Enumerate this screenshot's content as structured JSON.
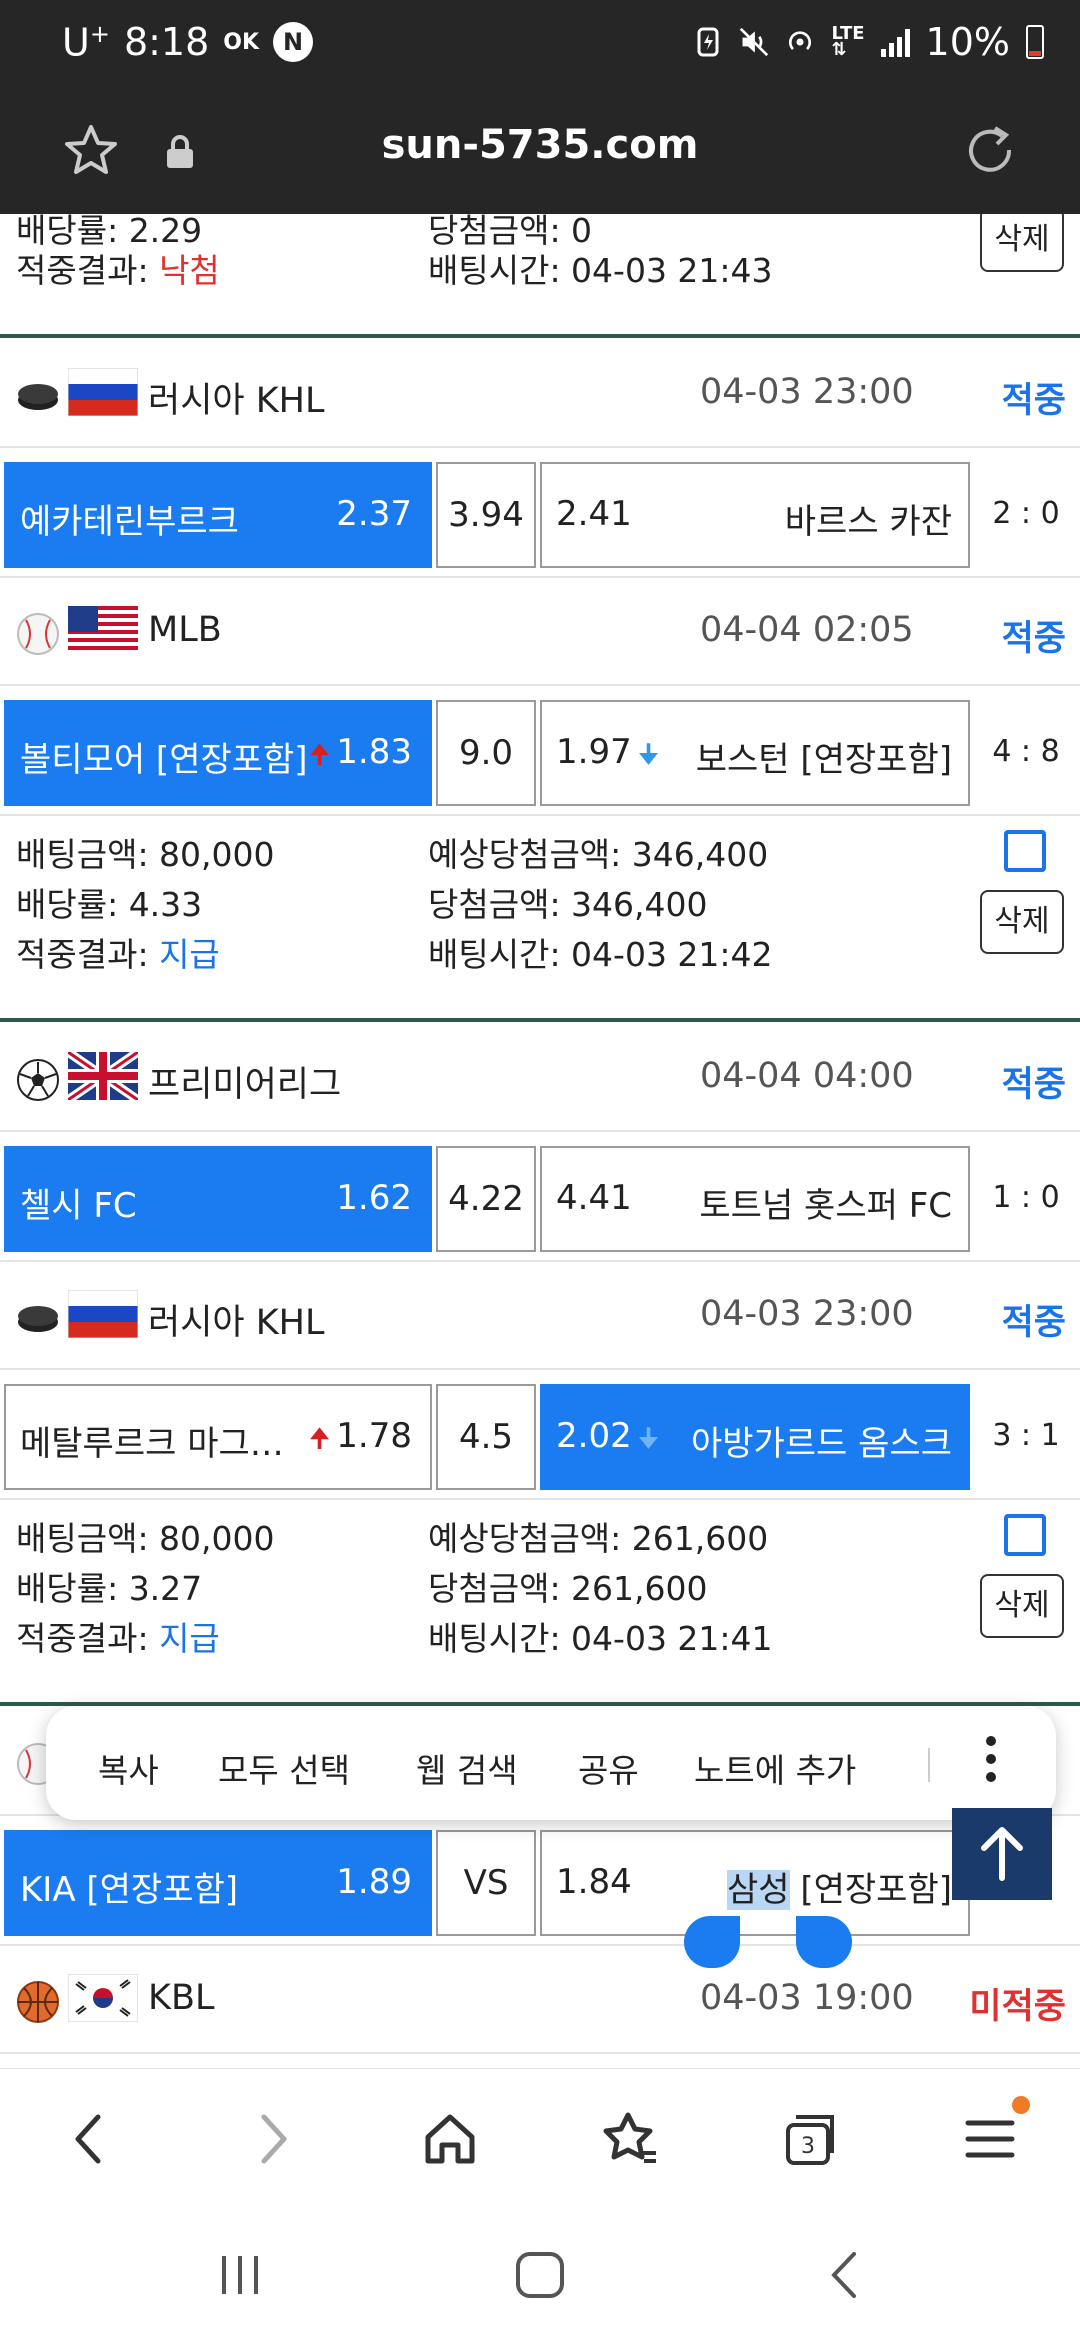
{
  "status_bar": {
    "carrier": "U",
    "carrier_sup": "+",
    "time": "8:18",
    "ok": "OK",
    "n_badge": "N",
    "lte": "LTE",
    "battery": "10%"
  },
  "url_bar": {
    "domain": "sun-5735.com"
  },
  "top_partial": {
    "left_line1": "배당률: 2.29",
    "right_line1": "당첨금액: 0",
    "result_label": "적중결과: ",
    "result_value": "낙첨",
    "bet_time": "배팅시간: 04-03 21:43",
    "delete": "삭제"
  },
  "matches": [
    {
      "sport_icon": "hockey-puck-icon",
      "flag": "russia-flag",
      "league": "러시아 KHL",
      "time": "04-03 23:00",
      "status": "적중",
      "home": "예카테린부르크",
      "home_odd": "2.37",
      "draw": "3.94",
      "away_odd": "2.41",
      "away": "바르스 카잔",
      "score": "2 : 0",
      "selected": "home"
    },
    {
      "sport_icon": "baseball-icon",
      "flag": "usa-flag",
      "league": "MLB",
      "time": "04-04 02:05",
      "status": "적중",
      "home": "볼티모어 [연장포함]",
      "home_odd": "1.83",
      "draw": "9.0",
      "away_odd": "1.97",
      "away": "보스턴 [연장포함]",
      "score": "4 : 8",
      "selected": "home"
    },
    {
      "sport_icon": "soccer-ball-icon",
      "flag": "uk-flag",
      "league": "프리미어리그",
      "time": "04-04 04:00",
      "status": "적중",
      "home": "첼시 FC",
      "home_odd": "1.62",
      "draw": "4.22",
      "away_odd": "4.41",
      "away": "토트넘 홋스퍼 FC",
      "score": "1 : 0",
      "selected": "home"
    },
    {
      "sport_icon": "hockey-puck-icon",
      "flag": "russia-flag",
      "league": "러시아 KHL",
      "time": "04-03 23:00",
      "status": "적중",
      "home": "메탈루르크 마그…",
      "home_odd": "1.78",
      "draw": "4.5",
      "away_odd": "2.02",
      "away": "아방가르드 옴스크",
      "score": "3 : 1",
      "selected": "away"
    },
    {
      "home": "KIA [연장포함]",
      "home_odd": "1.89",
      "draw": "VS",
      "away_odd": "1.84",
      "away_a": "삼성",
      "away_b": " [연장포함]",
      "selected": "home"
    },
    {
      "sport_icon": "basketball-icon",
      "flag": "korea-flag",
      "league": "KBL",
      "time": "04-03 19:00",
      "status": "미적중"
    }
  ],
  "bets": [
    {
      "amount": "배팅금액: 80,000",
      "odds": "배당률: 4.33",
      "result_label": "적중결과: ",
      "result_value": "지급",
      "expected": "예상당첨금액: 346,400",
      "won": "당첨금액: 346,400",
      "bet_time": "배팅시간: 04-03 21:42",
      "delete": "삭제"
    },
    {
      "amount": "배팅금액: 80,000",
      "odds": "배당률: 3.27",
      "result_label": "적중결과: ",
      "result_value": "지급",
      "expected": "예상당첨금액: 261,600",
      "won": "당첨금액: 261,600",
      "bet_time": "배팅시간: 04-03 21:41",
      "delete": "삭제"
    }
  ],
  "context_menu": {
    "copy": "복사",
    "select_all": "모두 선택",
    "web_search": "웹 검색",
    "share": "공유",
    "add_note": "노트에 추가"
  },
  "bottom_bar": {
    "tab_count": "3"
  },
  "colors": {
    "selected_blue": "#1a7cf0",
    "hit_blue": "#1a73e8",
    "miss_red": "#e03131",
    "separator_green": "#2e5a4a"
  }
}
